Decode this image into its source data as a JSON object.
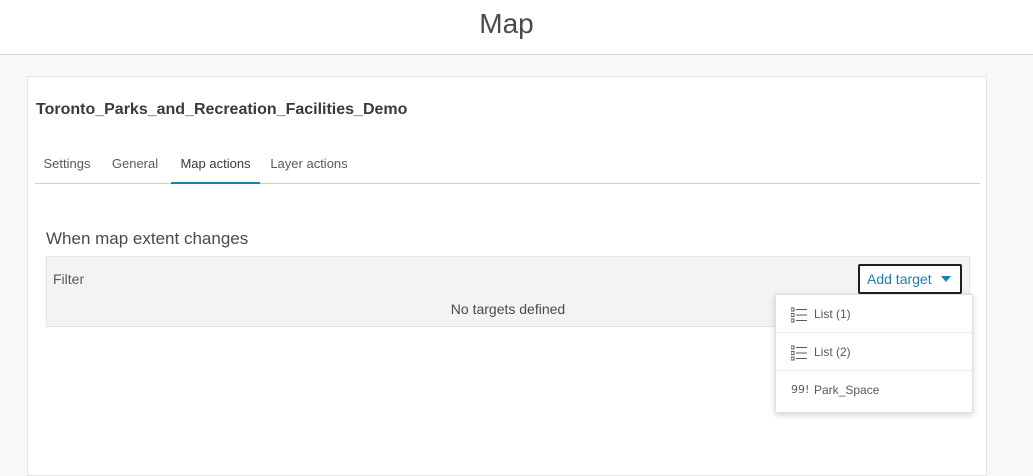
{
  "header": {
    "title": "Map"
  },
  "item": {
    "title": "Toronto_Parks_and_Recreation_Facilities_Demo"
  },
  "tabs": [
    {
      "label": "Settings"
    },
    {
      "label": "General"
    },
    {
      "label": "Map actions",
      "active": true
    },
    {
      "label": "Layer actions"
    }
  ],
  "section": {
    "title": "When map extent changes",
    "filter_label": "Filter",
    "empty_message": "No targets defined"
  },
  "add_target": {
    "label": "Add target"
  },
  "dropdown": {
    "items": [
      {
        "label": "List (1)",
        "icon": "list-icon"
      },
      {
        "label": "List (2)",
        "icon": "list-icon"
      },
      {
        "label": "Park_Space",
        "icon": "quote-icon",
        "icon_text": "99!"
      }
    ]
  },
  "colors": {
    "accent": "#1d7fb3",
    "text": "#4c4c4c",
    "background": "#f8f8f8"
  }
}
